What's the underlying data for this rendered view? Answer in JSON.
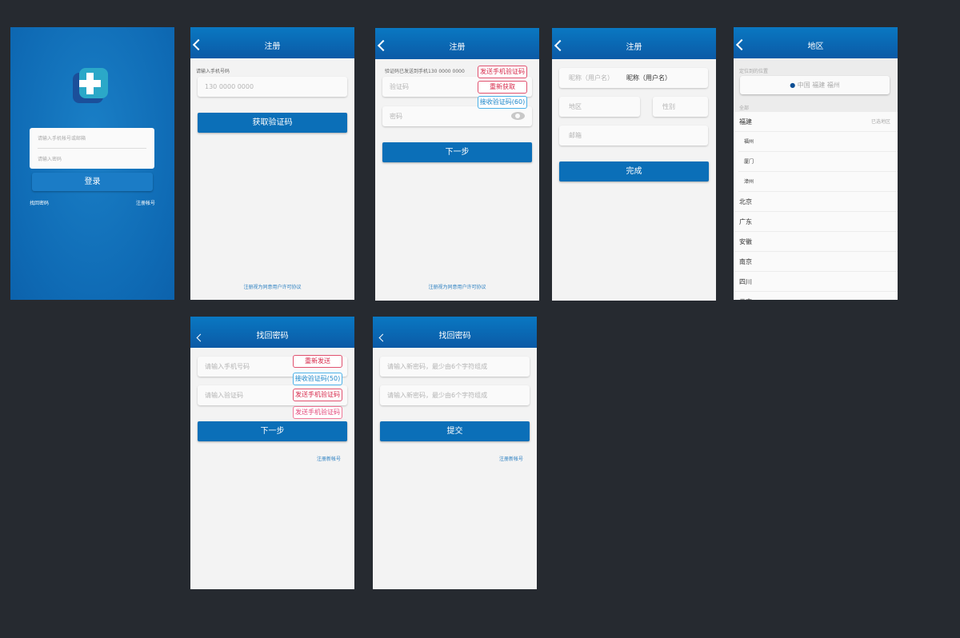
{
  "login": {
    "account_placeholder": "请输入手机帐号或邮箱",
    "password_placeholder": "请输入密码",
    "login_button": "登录",
    "forgot_password": "找回密码",
    "register": "注册帐号"
  },
  "register1": {
    "title": "注册",
    "phone_label": "请输入手机号码",
    "phone_placeholder": "130  0000  0000",
    "get_code_button": "获取验证码",
    "agreement": "注册视为同意用户许可协议"
  },
  "register2": {
    "title": "注册",
    "sent_info": "验证码已发送到手机130 0000 0000",
    "code_placeholder": "验证码",
    "password_placeholder": "密码",
    "tag_send": "发送手机验证码",
    "tag_resend": "重新获取",
    "tag_countdown": "接收验证码(60)",
    "next_button": "下一步",
    "agreement": "注册视为同意用户许可协议"
  },
  "register3": {
    "title": "注册",
    "nickname_label": "昵称（用户名）",
    "nickname_value": "昵称（用户名）",
    "region_placeholder": "地区",
    "gender_placeholder": "性别",
    "email_placeholder": "邮箱",
    "done_button": "完成"
  },
  "region": {
    "title": "地区",
    "located_label": "定位到的位置",
    "located_value": "中国 福建 福州",
    "all_label": "全部",
    "selected_hint": "已选地区",
    "items": [
      {
        "name": "福建",
        "sub": false
      },
      {
        "name": "福州",
        "sub": true
      },
      {
        "name": "厦门",
        "sub": true
      },
      {
        "name": "漳州",
        "sub": true
      },
      {
        "name": "北京",
        "sub": false
      },
      {
        "name": "广东",
        "sub": false
      },
      {
        "name": "安徽",
        "sub": false
      },
      {
        "name": "南京",
        "sub": false
      },
      {
        "name": "四川",
        "sub": false
      },
      {
        "name": "云南",
        "sub": false
      }
    ]
  },
  "forgot1": {
    "title": "找回密码",
    "phone_placeholder": "请输入手机号码",
    "code_placeholder": "请输入验证码",
    "tag_resend": "重新发送",
    "tag_countdown": "接收验证码(50)",
    "tag_send": "发送手机验证码",
    "tag_send2": "发送手机验证码",
    "next_button": "下一步",
    "register_link": "注册新帐号"
  },
  "forgot2": {
    "title": "找回密码",
    "new_password_placeholder": "请输入新密码，最少由6个字符组成",
    "confirm_password_placeholder": "请输入新密码，最少由6个字符组成",
    "submit_button": "提交",
    "register_link": "注册新帐号"
  },
  "colors": {
    "primary": "#0b6fb8",
    "background": "#262a30",
    "tag_red": "#d6284a",
    "tag_blue": "#1b86c9"
  }
}
